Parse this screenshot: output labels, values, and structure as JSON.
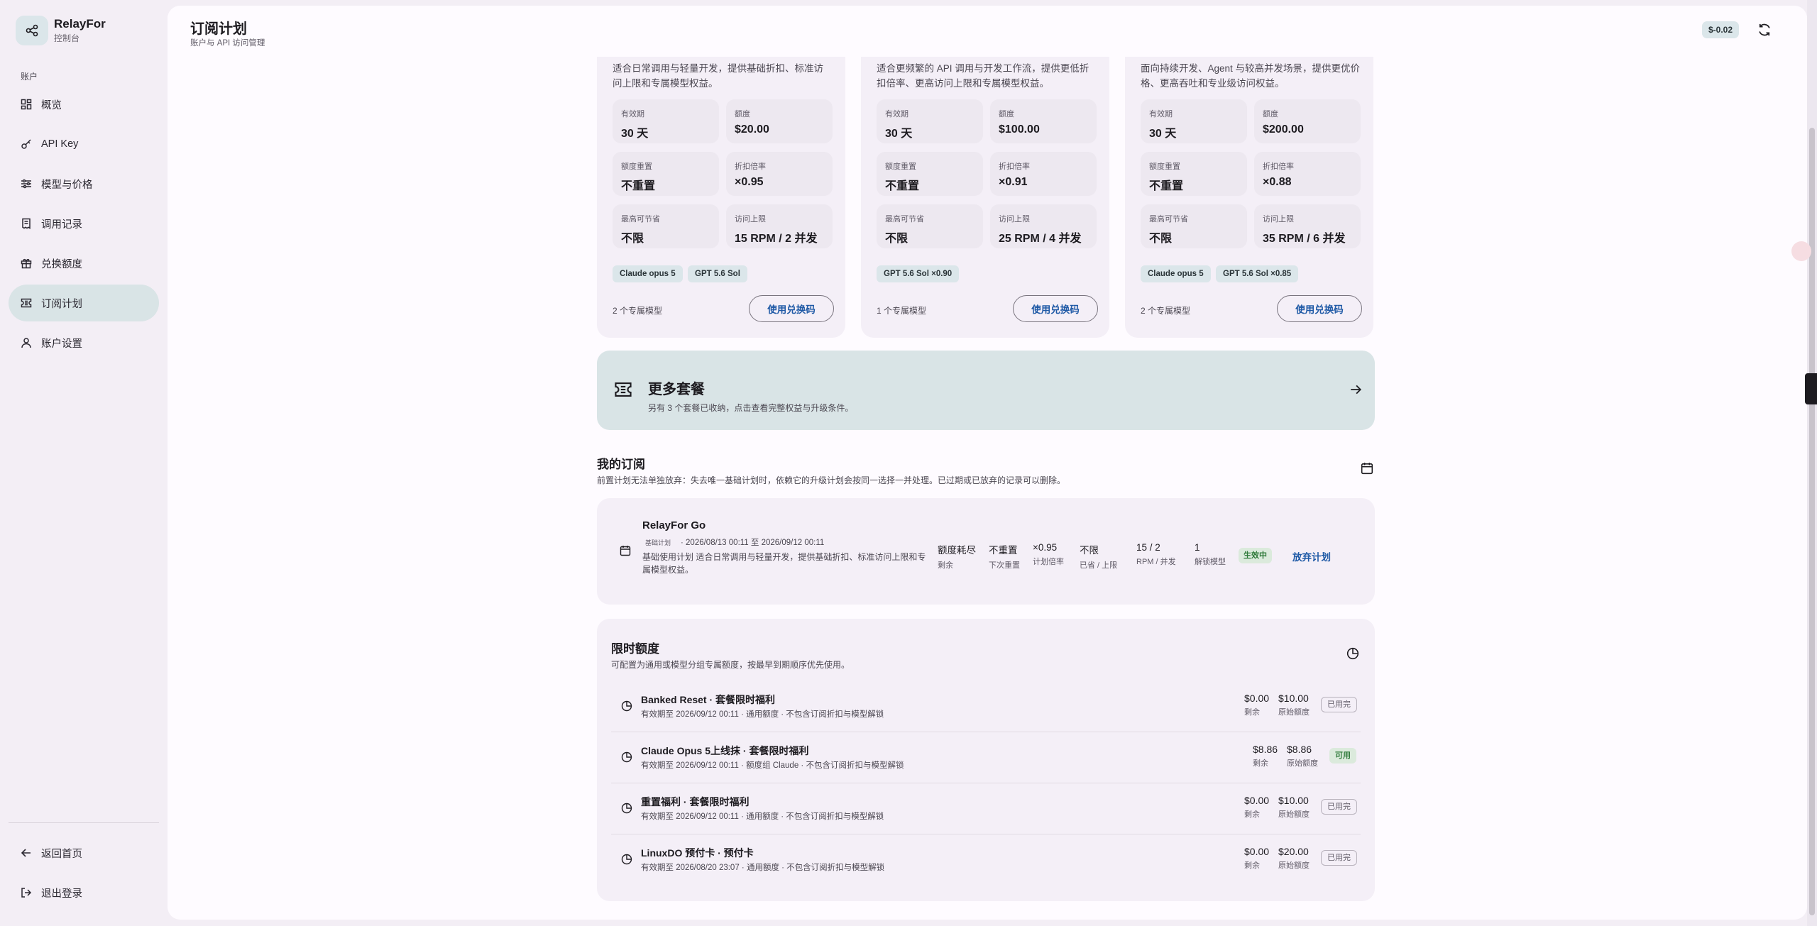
{
  "app": {
    "name": "RelayFor",
    "subtitle": "控制台"
  },
  "sidebar": {
    "section": "账户",
    "items": [
      {
        "label": "概览",
        "icon": "dashboard-icon"
      },
      {
        "label": "API Key",
        "icon": "key-icon"
      },
      {
        "label": "模型与价格",
        "icon": "sliders-icon"
      },
      {
        "label": "调用记录",
        "icon": "receipt-icon"
      },
      {
        "label": "兑换额度",
        "icon": "gift-icon"
      },
      {
        "label": "订阅计划",
        "icon": "ticket-icon",
        "active": true
      },
      {
        "label": "账户设置",
        "icon": "user-icon"
      }
    ],
    "bottom": [
      {
        "label": "返回首页",
        "icon": "arrow-left-icon"
      },
      {
        "label": "退出登录",
        "icon": "logout-icon"
      }
    ]
  },
  "header": {
    "title": "订阅计划",
    "subtitle": "账户与 API 访问管理",
    "balance": "$-0.02"
  },
  "plans": [
    {
      "desc": "适合日常调用与轻量开发，提供基础折扣、标准访问上限和专属模型权益。",
      "stats": [
        {
          "label": "有效期",
          "value": "30 天"
        },
        {
          "label": "额度",
          "value": "$20.00"
        },
        {
          "label": "额度重置",
          "value": "不重置"
        },
        {
          "label": "折扣倍率",
          "value": "×0.95"
        },
        {
          "label": "最高可节省",
          "value": "不限"
        },
        {
          "label": "访问上限",
          "value": "15 RPM / 2 并发"
        }
      ],
      "tags": [
        "Claude opus 5",
        "GPT 5.6 Sol"
      ],
      "model_count": "2 个专属模型",
      "button": "使用兑换码"
    },
    {
      "desc": "适合更频繁的 API 调用与开发工作流，提供更低折扣倍率、更高访问上限和专属模型权益。",
      "stats": [
        {
          "label": "有效期",
          "value": "30 天"
        },
        {
          "label": "额度",
          "value": "$100.00"
        },
        {
          "label": "额度重置",
          "value": "不重置"
        },
        {
          "label": "折扣倍率",
          "value": "×0.91"
        },
        {
          "label": "最高可节省",
          "value": "不限"
        },
        {
          "label": "访问上限",
          "value": "25 RPM / 4 并发"
        }
      ],
      "tags": [
        "GPT 5.6 Sol ×0.90"
      ],
      "model_count": "1 个专属模型",
      "button": "使用兑换码"
    },
    {
      "desc": "面向持续开发、Agent 与较高并发场景，提供更优价格、更高吞吐和专业级访问权益。",
      "stats": [
        {
          "label": "有效期",
          "value": "30 天"
        },
        {
          "label": "额度",
          "value": "$200.00"
        },
        {
          "label": "额度重置",
          "value": "不重置"
        },
        {
          "label": "折扣倍率",
          "value": "×0.88"
        },
        {
          "label": "最高可节省",
          "value": "不限"
        },
        {
          "label": "访问上限",
          "value": "35 RPM / 6 并发"
        }
      ],
      "tags": [
        "Claude opus 5",
        "GPT 5.6 Sol ×0.85"
      ],
      "model_count": "2 个专属模型",
      "button": "使用兑换码"
    }
  ],
  "more": {
    "title": "更多套餐",
    "subtitle": "另有 3 个套餐已收纳，点击查看完整权益与升级条件。"
  },
  "my_subs": {
    "title": "我的订阅",
    "subtitle": "前置计划无法单独放弃：失去唯一基础计划时，依赖它的升级计划会按同一选择一并处理。已过期或已放弃的记录可以删除。",
    "item": {
      "name": "RelayFor Go",
      "kind": "基础计划",
      "range": "· 2026/08/13 00:11 至 2026/09/12 00:11",
      "desc": "基础使用计划 适合日常调用与轻量开发，提供基础折扣、标准访问上限和专属模型权益。",
      "metrics": [
        {
          "value": "额度耗尽",
          "label": "剩余"
        },
        {
          "value": "不重置",
          "label": "下次重置"
        },
        {
          "value": "×0.95",
          "label": "计划倍率"
        },
        {
          "value": "不限",
          "label": "已省 / 上限"
        },
        {
          "value": "15 / 2",
          "label": "RPM / 并发"
        },
        {
          "value": "1",
          "label": "解锁模型"
        }
      ],
      "status": "生效中",
      "action": "放弃计划"
    }
  },
  "quota": {
    "title": "限时额度",
    "subtitle": "可配置为通用或模型分组专属额度，按最早到期顺序优先使用。",
    "rows": [
      {
        "name": "Banked Reset · 套餐限时福利",
        "meta": "有效期至 2026/09/12 00:11 · 通用额度 · 不包含订阅折扣与模型解锁",
        "remain": "$0.00",
        "remain_label": "剩余",
        "orig": "$10.00",
        "orig_label": "原始额度",
        "status": "已用完",
        "available": false
      },
      {
        "name": "Claude Opus 5上线抹 · 套餐限时福利",
        "meta": "有效期至 2026/09/12 00:11 · 额度组 Claude · 不包含订阅折扣与模型解锁",
        "remain": "$8.86",
        "remain_label": "剩余",
        "orig": "$8.86",
        "orig_label": "原始额度",
        "status": "可用",
        "available": true
      },
      {
        "name": "重置福利 · 套餐限时福利",
        "meta": "有效期至 2026/09/12 00:11 · 通用额度 · 不包含订阅折扣与模型解锁",
        "remain": "$0.00",
        "remain_label": "剩余",
        "orig": "$10.00",
        "orig_label": "原始额度",
        "status": "已用完",
        "available": false
      },
      {
        "name": "LinuxDO 预付卡 · 预付卡",
        "meta": "有效期至 2026/08/20 23:07 · 通用额度 · 不包含订阅折扣与模型解锁",
        "remain": "$0.00",
        "remain_label": "剩余",
        "orig": "$20.00",
        "orig_label": "原始额度",
        "status": "已用完",
        "available": false
      }
    ]
  }
}
